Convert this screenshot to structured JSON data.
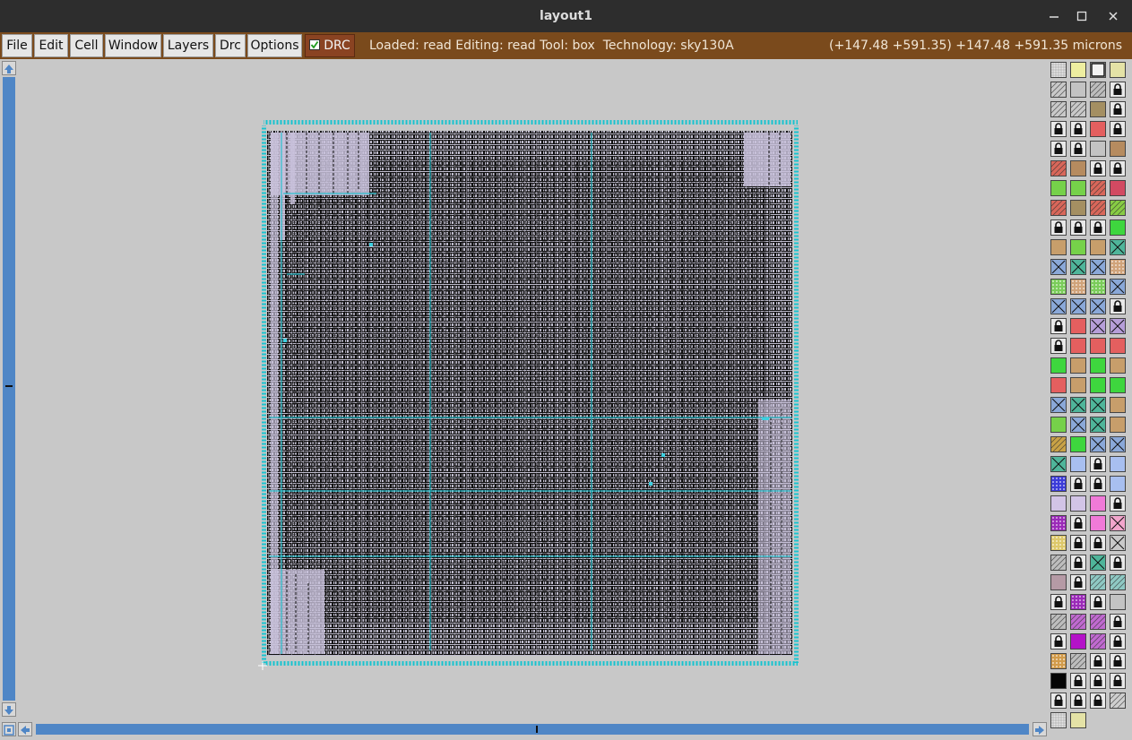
{
  "window": {
    "title": "layout1",
    "buttons": [
      "minimize-icon",
      "maximize-icon",
      "close-icon"
    ]
  },
  "menu": {
    "items": [
      "File",
      "Edit",
      "Cell",
      "Window",
      "Layers",
      "Drc",
      "Options"
    ],
    "drc_toggle": {
      "label": "DRC",
      "checked": true
    }
  },
  "status": {
    "text": "Loaded: read Editing: read Tool: box  Technology: sky130A",
    "coords": "(+147.48 +591.35) +147.48 +591.35 microns"
  },
  "palette": {
    "rows": [
      [
        "grid",
        "yellow",
        "white-outline",
        "yellow-light"
      ],
      [
        "diag-gray",
        "gray",
        "gray-diag",
        "lock"
      ],
      [
        "diag-gray",
        "diag-gray",
        "olive",
        "lock"
      ],
      [
        "lock",
        "lock",
        "red",
        "lock"
      ],
      [
        "lock",
        "lock",
        "gray",
        "brown"
      ],
      [
        "red-diag",
        "brown",
        "lock",
        "lock"
      ],
      [
        "green",
        "green",
        "red-diag",
        "crimson"
      ],
      [
        "red-diag",
        "olive",
        "red-diag",
        "green-diag"
      ],
      [
        "lock",
        "lock",
        "lock",
        "bright-green"
      ],
      [
        "tan",
        "green",
        "tan",
        "teal-x"
      ],
      [
        "blue-x",
        "teal-x",
        "blue-x",
        "tan-dots"
      ],
      [
        "green-dots",
        "tan-dots",
        "green-dots",
        "blue-x"
      ],
      [
        "blue-x",
        "blue-x",
        "blue-x",
        "lock"
      ],
      [
        "lock",
        "red",
        "purple-x",
        "purple-x"
      ],
      [
        "lock",
        "red",
        "red",
        "red"
      ],
      [
        "bright-green",
        "tan",
        "bright-green",
        "tan"
      ],
      [
        "red",
        "tan",
        "bright-green",
        "bright-green"
      ],
      [
        "blue-x",
        "teal-x",
        "teal-x",
        "tan"
      ],
      [
        "green",
        "blue-x",
        "teal-x",
        "tan"
      ],
      [
        "olive-diag",
        "bright-green",
        "blue-x",
        "blue-x"
      ],
      [
        "teal-x",
        "light-blue",
        "lock",
        "light-blue"
      ],
      [
        "blue-wave",
        "lock",
        "lock",
        "light-blue"
      ],
      [
        "lavender",
        "lavender",
        "pink",
        "lock"
      ],
      [
        "purple-dots",
        "lock",
        "pink",
        "pink-x"
      ],
      [
        "yellow-dots",
        "lock",
        "lock",
        "gray-x"
      ],
      [
        "gray-diag",
        "lock",
        "teal-x",
        "lock"
      ],
      [
        "mauve",
        "lock",
        "teal-diag",
        "teal-diag"
      ],
      [
        "lock",
        "purple-dots",
        "lock",
        "gray"
      ],
      [
        "gray-diag",
        "purple-diag",
        "purple-diag",
        "lock"
      ],
      [
        "lock",
        "magenta",
        "purple-diag",
        "lock"
      ],
      [
        "orange-dots",
        "gray-lines",
        "lock",
        "lock"
      ],
      [
        "black",
        "lock",
        "lock",
        "lock"
      ],
      [
        "lock",
        "lock",
        "lock",
        "diag-line"
      ],
      [
        "grid",
        "yellow-light"
      ]
    ]
  }
}
